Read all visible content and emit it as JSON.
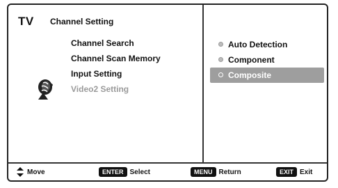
{
  "header": {
    "tv_label": "TV",
    "menu_title": "Channel Setting"
  },
  "menu": {
    "items": [
      {
        "label": "Channel Search"
      },
      {
        "label": "Channel Scan Memory"
      },
      {
        "label": "Input Setting"
      },
      {
        "label": "Video2 Setting"
      }
    ]
  },
  "options": {
    "items": [
      {
        "label": "Auto Detection"
      },
      {
        "label": "Component"
      },
      {
        "label": "Composite"
      }
    ],
    "selected_index": 2
  },
  "footer": {
    "move_label": "Move",
    "select_key": "ENTER",
    "select_label": "Select",
    "return_key": "MENU",
    "return_label": "Return",
    "exit_key": "EXIT",
    "exit_label": "Exit"
  },
  "icons": {
    "logo": "satellite-dish-icon",
    "move": "up-down-arrows-icon",
    "bullet": "radio-bullet-icon"
  },
  "colors": {
    "highlight": "#9e9e9e",
    "disabled_text": "#9a9a9a",
    "key_background": "#111111"
  }
}
